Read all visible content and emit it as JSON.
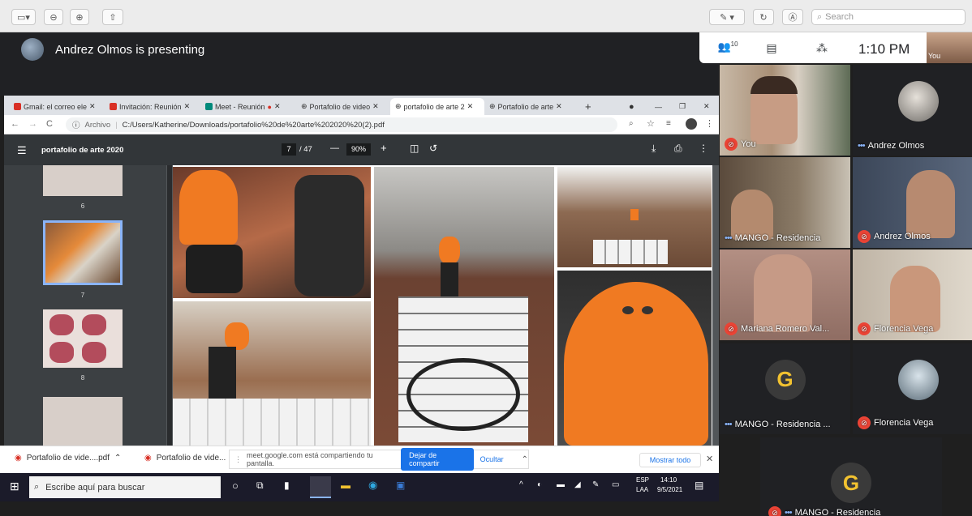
{
  "mac_toolbar": {
    "search_placeholder": "Search"
  },
  "presenting": {
    "text": "Andrez Olmos is presenting"
  },
  "meet_bar": {
    "participants_count": "10",
    "time": "1:10 PM",
    "self_label": "You"
  },
  "tiles": [
    {
      "name": "You",
      "muted": true
    },
    {
      "name": "Andrez Olmos",
      "muted": false
    },
    {
      "name": "MANGO - Residencia",
      "muted": false
    },
    {
      "name": "Andrez Olmos",
      "muted": true
    },
    {
      "name": "Mariana Romero Val...",
      "muted": true
    },
    {
      "name": "Florencia Vega",
      "muted": true
    },
    {
      "name": "MANGO - Residencia ...",
      "muted": false
    },
    {
      "name": "Florencia Vega",
      "muted": true
    },
    {
      "name": "MANGO - Residencia",
      "muted": true
    }
  ],
  "browser": {
    "tabs": [
      {
        "label": "Gmail: el correo ele",
        "color": "#d93025"
      },
      {
        "label": "Invitación: Reunión",
        "color": "#d93025"
      },
      {
        "label": "Meet - Reunión",
        "color": "#00897b"
      },
      {
        "label": "Portafolio de video",
        "color": "#555555"
      },
      {
        "label": "portafolio de arte 2",
        "color": "#555555"
      },
      {
        "label": "Portafolio de arte",
        "color": "#555555"
      }
    ],
    "address_prefix": "Archivo",
    "address": "C:/Users/Katherine/Downloads/portafolio%20de%20arte%202020%20(2).pdf"
  },
  "pdf": {
    "title": "portafolio de arte 2020",
    "page_current": "7",
    "page_total": "/ 47",
    "zoom": "90%",
    "thumb_numbers": [
      "6",
      "7",
      "8"
    ]
  },
  "downloads": {
    "items": [
      "Portafolio de vide....pdf",
      "Portafolio de vide..."
    ],
    "share_text": "meet.google.com está compartiendo tu pantalla.",
    "stop_share": "Dejar de compartir",
    "hide": "Ocultar",
    "show_all": "Mostrar todo"
  },
  "taskbar": {
    "search_placeholder": "Escribe aquí para buscar",
    "lang": "ESP",
    "lang2": "LAA",
    "time": "14:10",
    "date": "9/5/2021"
  },
  "colors": {
    "meet_dark": "#202124",
    "mute_red": "#ea4335",
    "stop_share_blue": "#1a73e8",
    "poncho_orange": "#f07a22"
  }
}
